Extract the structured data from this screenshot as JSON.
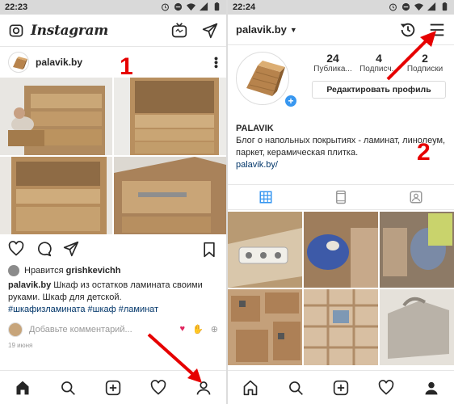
{
  "left": {
    "status": {
      "time": "22:23"
    },
    "app_title": "Instagram",
    "post": {
      "username": "palavik.by",
      "liked_by_prefix": "Нравится",
      "liked_by_user": "grishkevichh",
      "caption_user": "palavik.by",
      "caption_text": " Шкаф из остатков ламината своими руками. Шкаф для детской.",
      "hashtags": "#шкафизламината #шкаф #ламинат",
      "comment_placeholder": "Добавьте комментарий...",
      "date": "19 июня"
    }
  },
  "right": {
    "status": {
      "time": "22:24"
    },
    "profile_handle": "palavik.by",
    "stats": [
      {
        "num": "24",
        "label": "Публика..."
      },
      {
        "num": "4",
        "label": "Подписч..."
      },
      {
        "num": "2",
        "label": "Подписки"
      }
    ],
    "edit_label": "Редактировать профиль",
    "bio_name": "PALAVIK",
    "bio_text": "Блог о напольных покрытиях - ламинат, линолеум, паркет, керамическая плитка.",
    "bio_link": "palavik.by/"
  },
  "annotations": {
    "one": "1",
    "two": "2"
  },
  "colors": {
    "accent": "#3897f0",
    "annotation": "#e60000",
    "wood": "#c7a57b"
  }
}
